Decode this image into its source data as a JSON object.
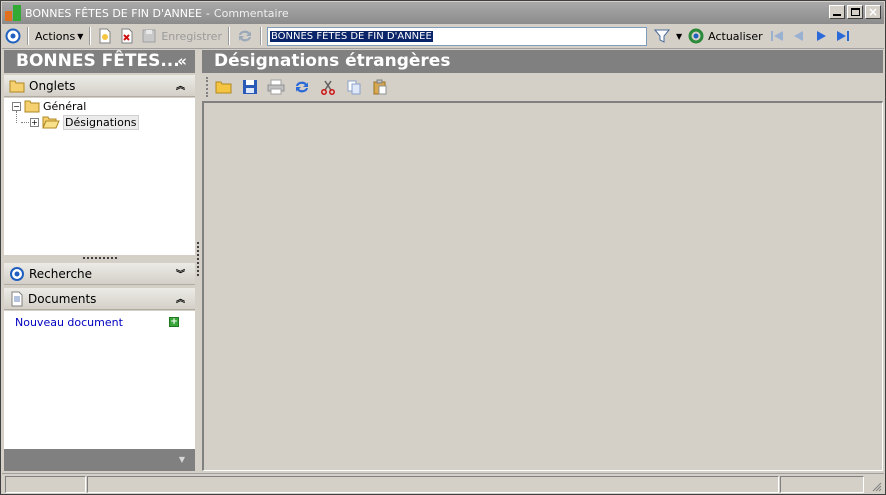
{
  "window": {
    "title": "BONNES FÊTES DE FIN D'ANNEE",
    "title_sep": "-",
    "subtitle": "Commentaire"
  },
  "toolbar": {
    "actions_label": "Actions",
    "save_label": "Enregistrer",
    "title_value": "BONNES FÊTES DE FIN D'ANNEE",
    "refresh_label": "Actualiser"
  },
  "left_panel": {
    "header": "BONNES FÊTES...",
    "collapse_glyph": "«",
    "tabs_section": "Onglets",
    "tree": {
      "root": "Général",
      "child": "Désignations"
    },
    "search_section": "Recherche",
    "documents_section": "Documents",
    "new_document": "Nouveau document"
  },
  "right_panel": {
    "header": "Désignations étrangères"
  },
  "colors": {
    "header_bg": "#808080",
    "selection_bg": "#0a246a",
    "link": "#0000c0",
    "accent_green": "#3aa53a"
  }
}
